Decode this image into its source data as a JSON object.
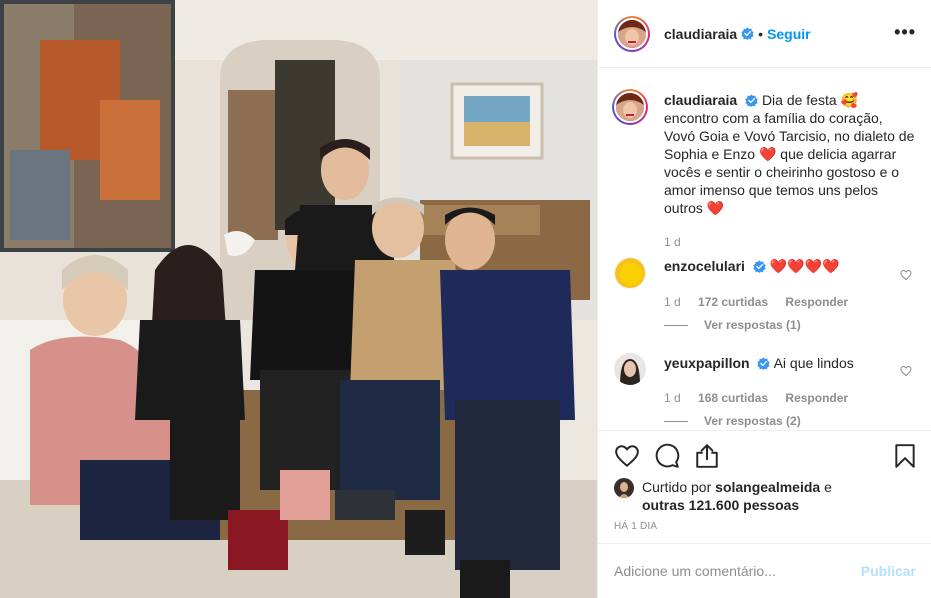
{
  "post": {
    "photo_alt": "Family group photo on a sofa",
    "author": "claudiaraia",
    "follow_label": "Seguir",
    "separator": "•",
    "more_label": "•••",
    "caption_text": "Dia de festa 🥰 encontro com a família do coração, Vovó Goia e Vovó Tarcisio, no dialeto de Sophia e Enzo ❤️ que delicia agarrar vocês e sentir o cheirinho gostoso e o amor imenso que temos uns pelos outros ❤️",
    "caption_age": "1 d"
  },
  "comments": [
    {
      "user": "enzocelulari",
      "text": "❤️❤️❤️❤️",
      "age": "1 d",
      "likes": "172 curtidas",
      "reply_label": "Responder",
      "view_replies": "Ver respostas (1)"
    },
    {
      "user": "yeuxpapillon",
      "text": "Ai que lindos",
      "age": "1 d",
      "likes": "168 curtidas",
      "reply_label": "Responder",
      "view_replies": "Ver respostas (2)"
    }
  ],
  "likes_section": {
    "prefix": "Curtido por",
    "liker": "solangealmeida",
    "conjunction": "e",
    "others": "outras 121.600 pessoas",
    "timestamp": "HÁ 1 DIA"
  },
  "comment_box": {
    "placeholder": "Adicione um comentário...",
    "publish_label": "Publicar"
  },
  "colors": {
    "accent": "#0095f6",
    "publish_disabled": "#b2dffc",
    "muted": "#8e8e8e",
    "verified": "#3897f0"
  }
}
